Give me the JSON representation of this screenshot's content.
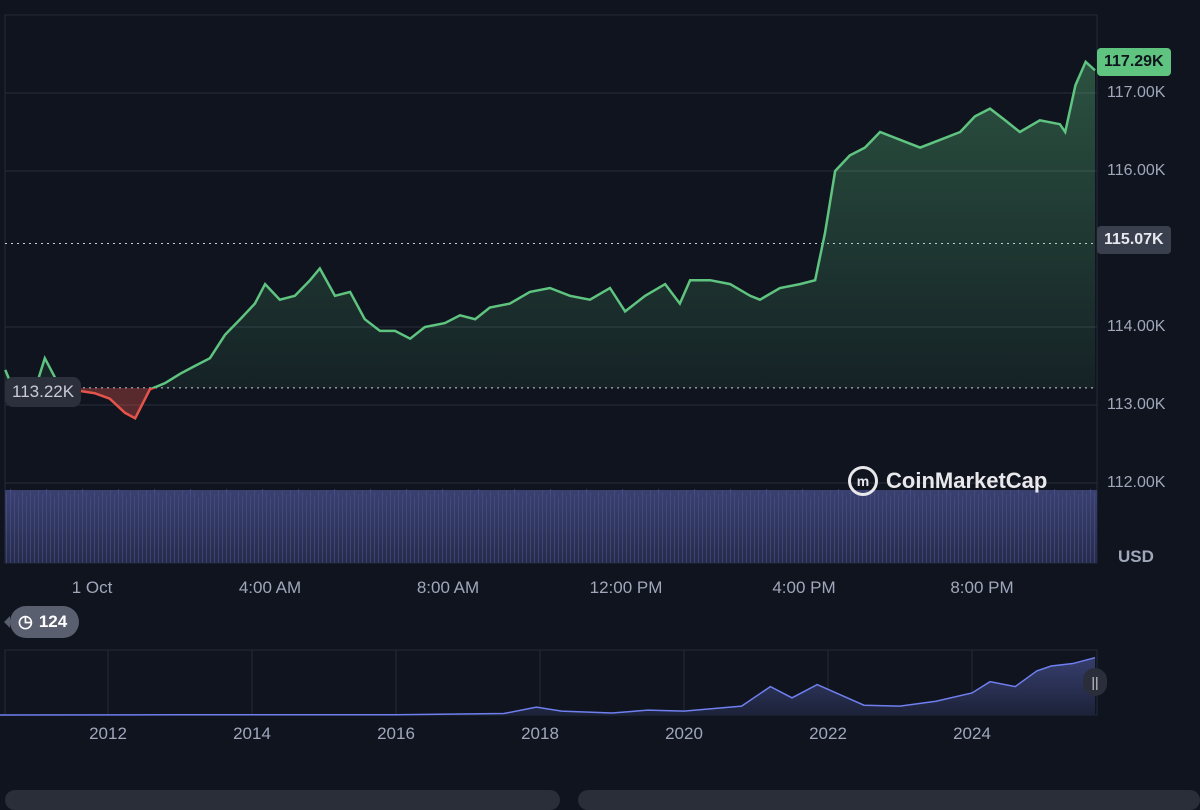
{
  "chart_data": [
    {
      "type": "line",
      "title": "",
      "currency": "USD",
      "ylim": [
        111.75,
        117.9
      ],
      "yticks": [
        "117.00K",
        "116.00K",
        "114.00K",
        "113.00K",
        "112.00K"
      ],
      "ytick_values": [
        117,
        116,
        114,
        113,
        112
      ],
      "xticks": [
        "1 Oct",
        "4:00 AM",
        "8:00 AM",
        "12:00 PM",
        "4:00 PM",
        "8:00 PM"
      ],
      "xtick_hours": [
        0,
        4,
        8,
        12,
        16,
        20
      ],
      "xlim_hours": [
        -1.95,
        22.6
      ],
      "open_price": 113.22,
      "open_label": "113.22K",
      "prev_close": 115.07,
      "prev_close_label": "115.07K",
      "last_price": 117.29,
      "last_label": "117.29K",
      "x_hours": [
        -1.95,
        -1.73,
        -1.28,
        -1.06,
        -0.83,
        -0.49,
        0.07,
        0.4,
        0.74,
        0.97,
        1.3,
        1.64,
        1.98,
        2.31,
        2.65,
        2.99,
        3.33,
        3.66,
        3.89,
        4.22,
        4.56,
        4.9,
        5.12,
        5.46,
        5.8,
        6.13,
        6.47,
        6.81,
        7.15,
        7.48,
        7.93,
        8.27,
        8.61,
        8.94,
        9.39,
        9.84,
        10.29,
        10.74,
        11.19,
        11.64,
        11.98,
        12.43,
        12.88,
        13.21,
        13.44,
        13.89,
        14.34,
        14.79,
        15.01,
        15.46,
        15.91,
        16.25,
        16.47,
        16.7,
        17.03,
        17.37,
        17.71,
        18.16,
        18.61,
        19.06,
        19.51,
        19.84,
        20.18,
        20.52,
        20.85,
        21.3,
        21.75,
        21.87,
        22.1,
        22.33,
        22.54
      ],
      "y_thousands_usd": [
        113.45,
        113.15,
        113.2,
        113.6,
        113.35,
        113.2,
        113.15,
        113.08,
        112.9,
        112.83,
        113.2,
        113.28,
        113.4,
        113.5,
        113.6,
        113.9,
        114.1,
        114.3,
        114.55,
        114.35,
        114.4,
        114.6,
        114.75,
        114.4,
        114.45,
        114.1,
        113.95,
        113.95,
        113.85,
        114,
        114.05,
        114.15,
        114.1,
        114.25,
        114.3,
        114.45,
        114.5,
        114.4,
        114.35,
        114.5,
        114.2,
        114.4,
        114.55,
        114.3,
        114.6,
        114.6,
        114.55,
        114.4,
        114.35,
        114.5,
        114.55,
        114.6,
        115.2,
        116.0,
        116.2,
        116.3,
        116.5,
        116.4,
        116.3,
        116.4,
        116.5,
        116.7,
        116.8,
        116.65,
        116.5,
        116.65,
        116.6,
        116.5,
        117.1,
        117.4,
        117.29
      ],
      "colors": {
        "up": "#5fc480",
        "down": "#e5544b"
      }
    },
    {
      "type": "area",
      "name": "navigator",
      "xticks": [
        "2012",
        "2014",
        "2016",
        "2018",
        "2020",
        "2022",
        "2024"
      ],
      "xtick_years": [
        2012,
        2014,
        2016,
        2018,
        2020,
        2022,
        2024
      ],
      "xlim_years": [
        2010.5,
        2025.75
      ],
      "x_years": [
        2010.5,
        2013,
        2016,
        2017.5,
        2017.95,
        2018.3,
        2019,
        2019.5,
        2020,
        2020.8,
        2021.2,
        2021.5,
        2021.85,
        2022.5,
        2023,
        2023.5,
        2024,
        2024.25,
        2024.6,
        2024.9,
        2025.1,
        2025.4,
        2025.75
      ],
      "y_thousands_usd": [
        0,
        0.5,
        0.5,
        3,
        16,
        8,
        4,
        10,
        8,
        18,
        58,
        35,
        62,
        20,
        18,
        28,
        45,
        68,
        58,
        90,
        100,
        105,
        117
      ],
      "color": "#6f7ff0"
    }
  ],
  "badge": {
    "count": "124",
    "icon": "history-icon"
  },
  "watermark": "CoinMarketCap",
  "currency_label": "USD"
}
